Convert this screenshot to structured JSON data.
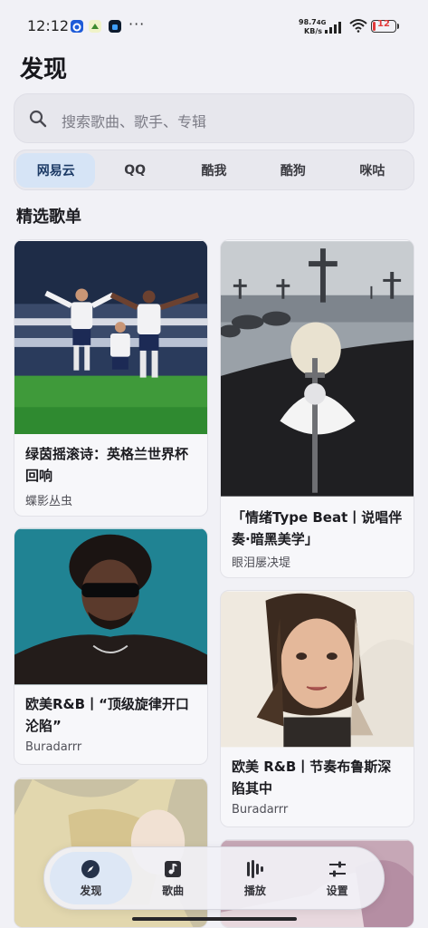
{
  "status": {
    "time": "12:12",
    "net_speed_value": "98.7",
    "net_type": "4G",
    "net_speed_unit": "KB/s",
    "battery": "12"
  },
  "page": {
    "title": "发现"
  },
  "search": {
    "placeholder": "搜索歌曲、歌手、专辑"
  },
  "sources": {
    "tabs": [
      "网易云",
      "QQ",
      "酷我",
      "酷狗",
      "咪咕"
    ],
    "active": "网易云"
  },
  "section": {
    "title": "精选歌单"
  },
  "playlists": [
    {
      "title": "绿茵摇滚诗：英格兰世界杯回响",
      "author": "蝶影丛虫"
    },
    {
      "title": "「情绪Type Beat丨说唱伴奏·暗黑美学」",
      "author": "眼泪屡决堤"
    },
    {
      "title": "欧美R&B丨“顶级旋律开口沦陷”",
      "author": "Buradarrr"
    },
    {
      "title": "欧美 R&B丨节奏布鲁斯深陷其中",
      "author": "Buradarrr"
    }
  ],
  "nav": {
    "items": [
      {
        "label": "发现",
        "icon": "compass-icon"
      },
      {
        "label": "歌曲",
        "icon": "music-library-icon"
      },
      {
        "label": "播放",
        "icon": "waveform-icon"
      },
      {
        "label": "设置",
        "icon": "sliders-icon"
      }
    ],
    "active": "发现"
  },
  "colors": {
    "active_tab": "#d6e4f6",
    "background": "#f1f1f6",
    "battery_low": "#e23b3b"
  }
}
